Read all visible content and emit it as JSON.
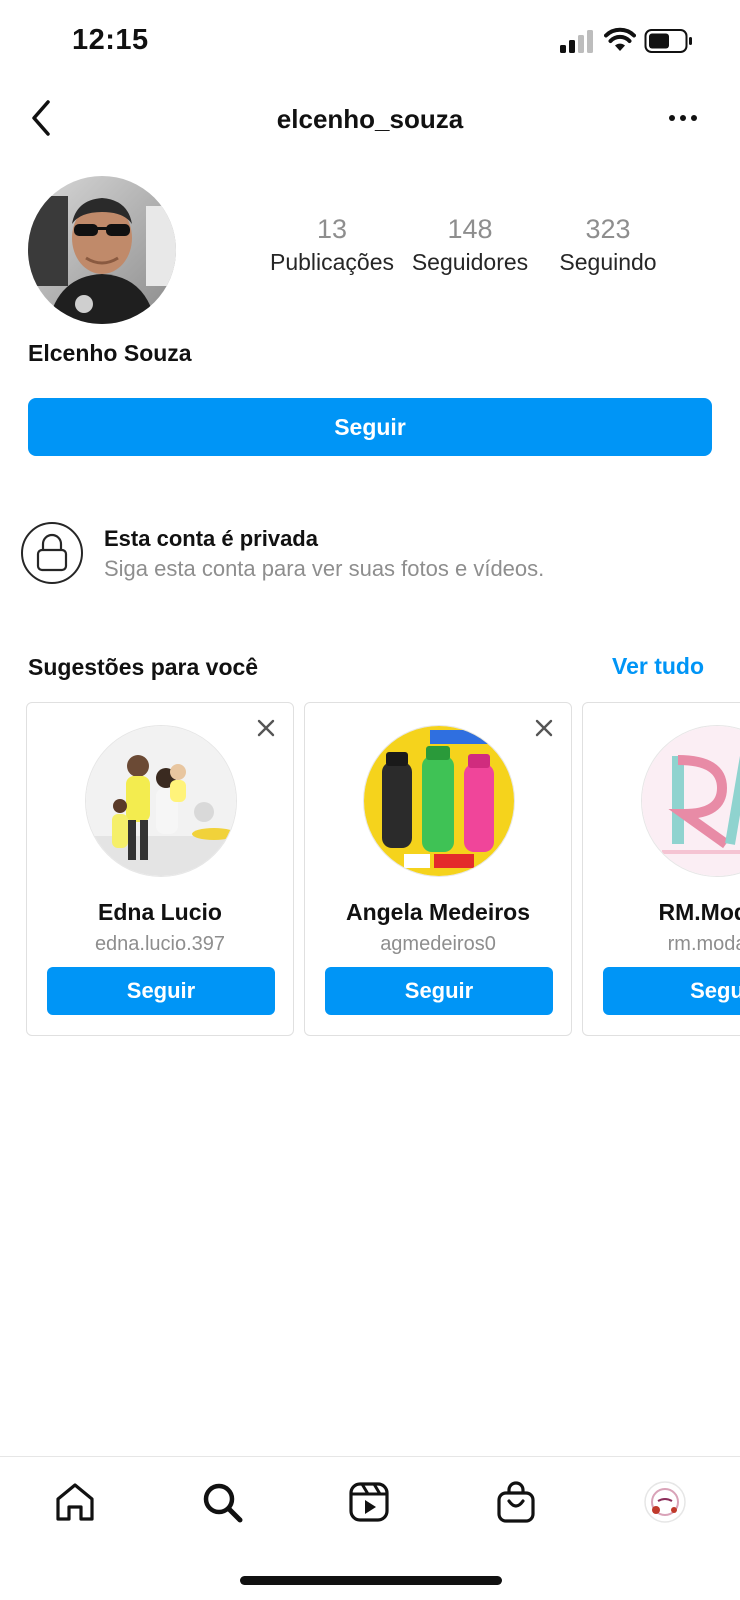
{
  "status_bar": {
    "time": "12:15"
  },
  "header": {
    "username": "elcenho_souza"
  },
  "profile": {
    "display_name": "Elcenho Souza",
    "stats": [
      {
        "value": "13",
        "label": "Publicações"
      },
      {
        "value": "148",
        "label": "Seguidores"
      },
      {
        "value": "323",
        "label": "Seguindo"
      }
    ],
    "follow_label": "Seguir"
  },
  "private": {
    "title": "Esta conta é privada",
    "subtitle": "Siga esta conta para ver suas fotos e vídeos."
  },
  "suggestions": {
    "title": "Sugestões para você",
    "see_all": "Ver tudo",
    "cards": [
      {
        "name": "Edna Lucio",
        "handle": "edna.lucio.397",
        "button": "Seguir"
      },
      {
        "name": "Angela Medeiros",
        "handle": "agmedeiros0",
        "button": "Seguir"
      },
      {
        "name": "RM.Modae",
        "handle": "rm.modaer",
        "button": "Segu"
      }
    ]
  },
  "tabs": [
    "home-icon",
    "search-icon",
    "reels-icon",
    "shop-icon",
    "profile-avatar"
  ],
  "colors": {
    "accent": "#0095f6",
    "muted": "#8e8e8e"
  }
}
